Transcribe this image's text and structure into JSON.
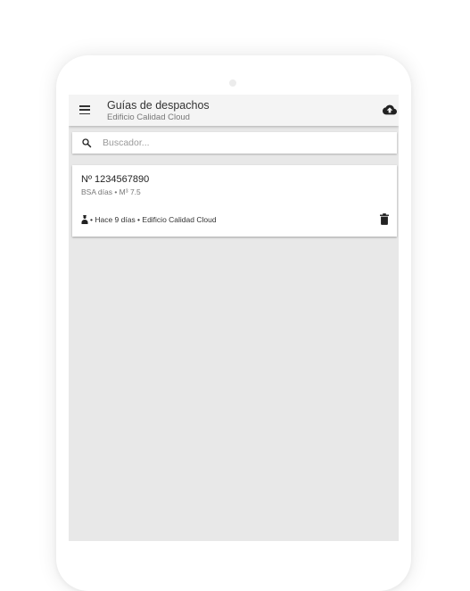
{
  "app": {
    "title": "Guías de despachos",
    "subtitle": "Edificio Calidad Cloud"
  },
  "icons": {
    "menu": "menu-icon",
    "upload": "cloud-upload-icon",
    "search": "search-icon",
    "user": "user-icon",
    "delete": "trash-icon"
  },
  "search": {
    "placeholder": "Buscador...",
    "value": ""
  },
  "guides": [
    {
      "number": "Nº 1234567890",
      "details": "BSA días • M³ 7.5",
      "meta": " • Hace 9 días • Edificio Calidad Cloud"
    }
  ],
  "colors": {
    "appbar": "#f4f4f4",
    "background": "#e8e8e8",
    "card": "#ffffff",
    "icon": "#222222"
  }
}
